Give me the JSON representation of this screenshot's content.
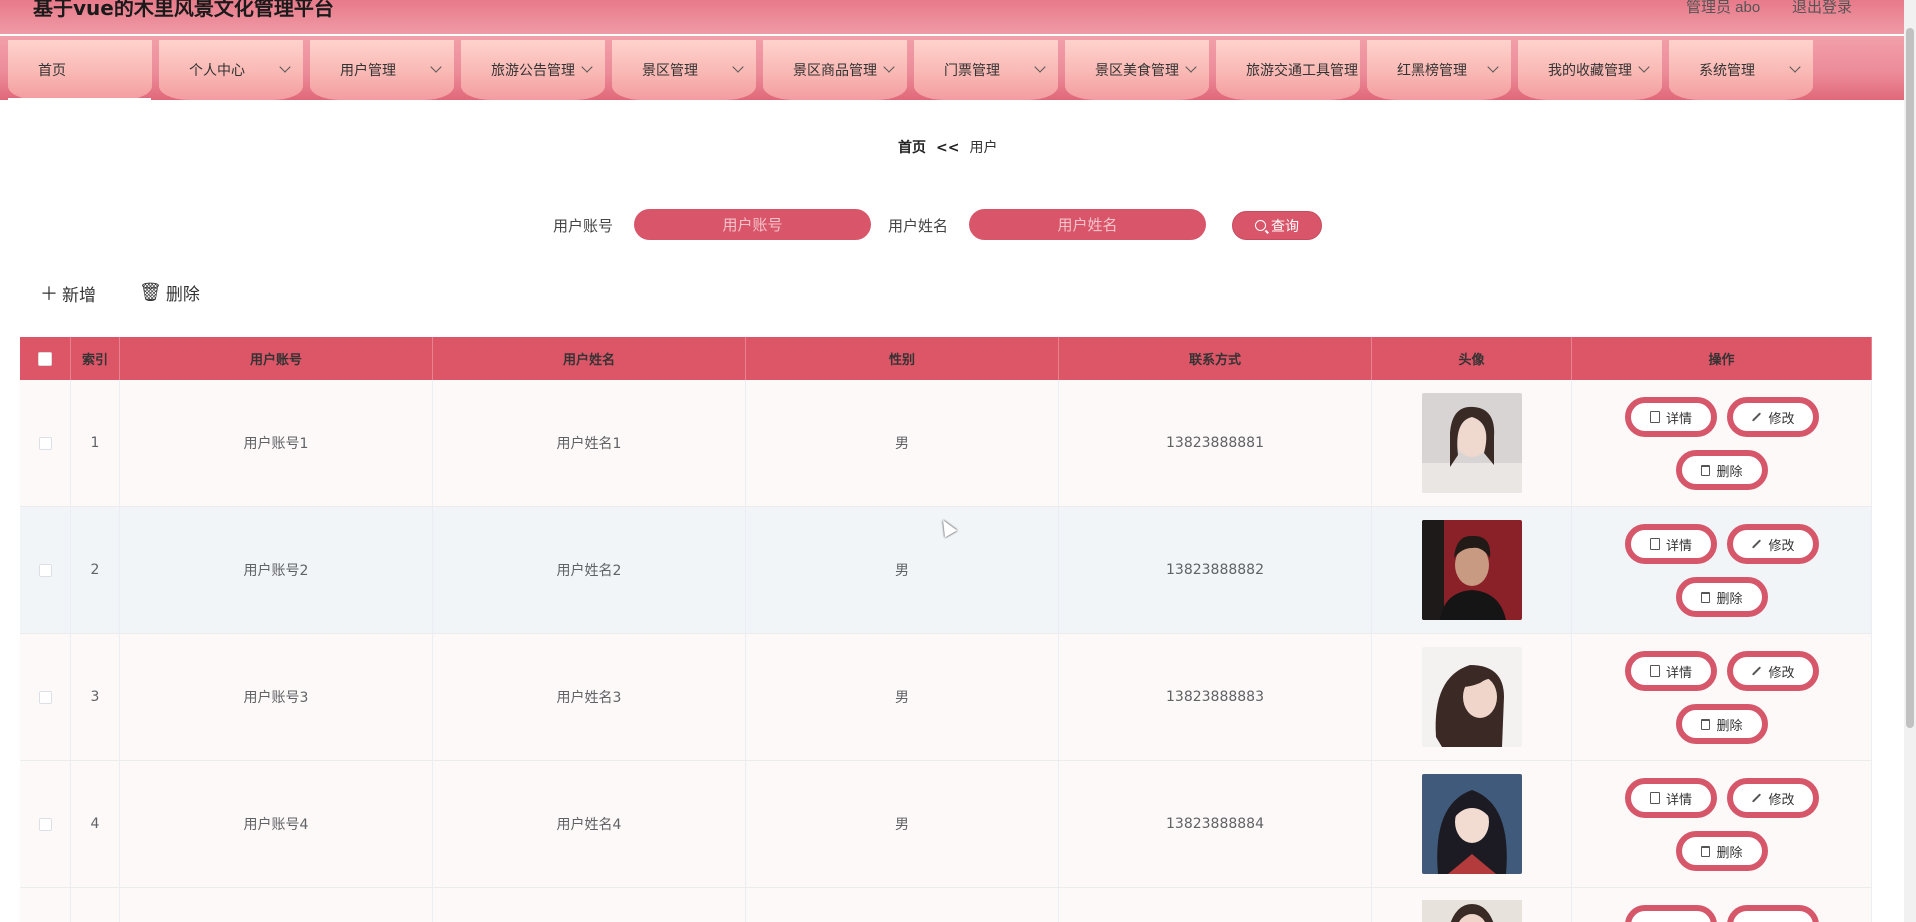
{
  "header": {
    "title": "基于vue的木里风景文化管理平台",
    "admin_text": "管理员 abo",
    "logout": "退出登录"
  },
  "nav": {
    "items": [
      {
        "label": "首页",
        "has_menu": false
      },
      {
        "label": "个人中心",
        "has_menu": true
      },
      {
        "label": "用户管理",
        "has_menu": true
      },
      {
        "label": "旅游公告管理",
        "has_menu": true
      },
      {
        "label": "景区管理",
        "has_menu": true
      },
      {
        "label": "景区商品管理",
        "has_menu": true
      },
      {
        "label": "门票管理",
        "has_menu": true
      },
      {
        "label": "景区美食管理",
        "has_menu": true
      },
      {
        "label": "旅游交通工具管理",
        "has_menu": false
      },
      {
        "label": "红黑榜管理",
        "has_menu": true
      },
      {
        "label": "我的收藏管理",
        "has_menu": true
      },
      {
        "label": "系统管理",
        "has_menu": true
      }
    ]
  },
  "breadcrumb": {
    "home": "首页",
    "sep": "<<",
    "current": "用户"
  },
  "search": {
    "account_label": "用户账号",
    "account_placeholder": "用户账号",
    "name_label": "用户姓名",
    "name_placeholder": "用户姓名",
    "button": "查询"
  },
  "actions": {
    "add": "新增",
    "delete": "删除"
  },
  "table": {
    "headers": [
      "索引",
      "用户账号",
      "用户姓名",
      "性别",
      "联系方式",
      "头像",
      "操作"
    ],
    "rows": [
      {
        "index": "1",
        "account": "用户账号1",
        "name": "用户姓名1",
        "gender": "男",
        "phone": "13823888881"
      },
      {
        "index": "2",
        "account": "用户账号2",
        "name": "用户姓名2",
        "gender": "男",
        "phone": "13823888882"
      },
      {
        "index": "3",
        "account": "用户账号3",
        "name": "用户姓名3",
        "gender": "男",
        "phone": "13823888883"
      },
      {
        "index": "4",
        "account": "用户账号4",
        "name": "用户姓名4",
        "gender": "男",
        "phone": "13823888884"
      }
    ],
    "row_buttons": {
      "detail": "详情",
      "edit": "修改",
      "delete": "删除"
    }
  },
  "colors": {
    "accent": "#dd5667",
    "nav_tab": "#f9b8b4",
    "header": "#e87a8a"
  }
}
